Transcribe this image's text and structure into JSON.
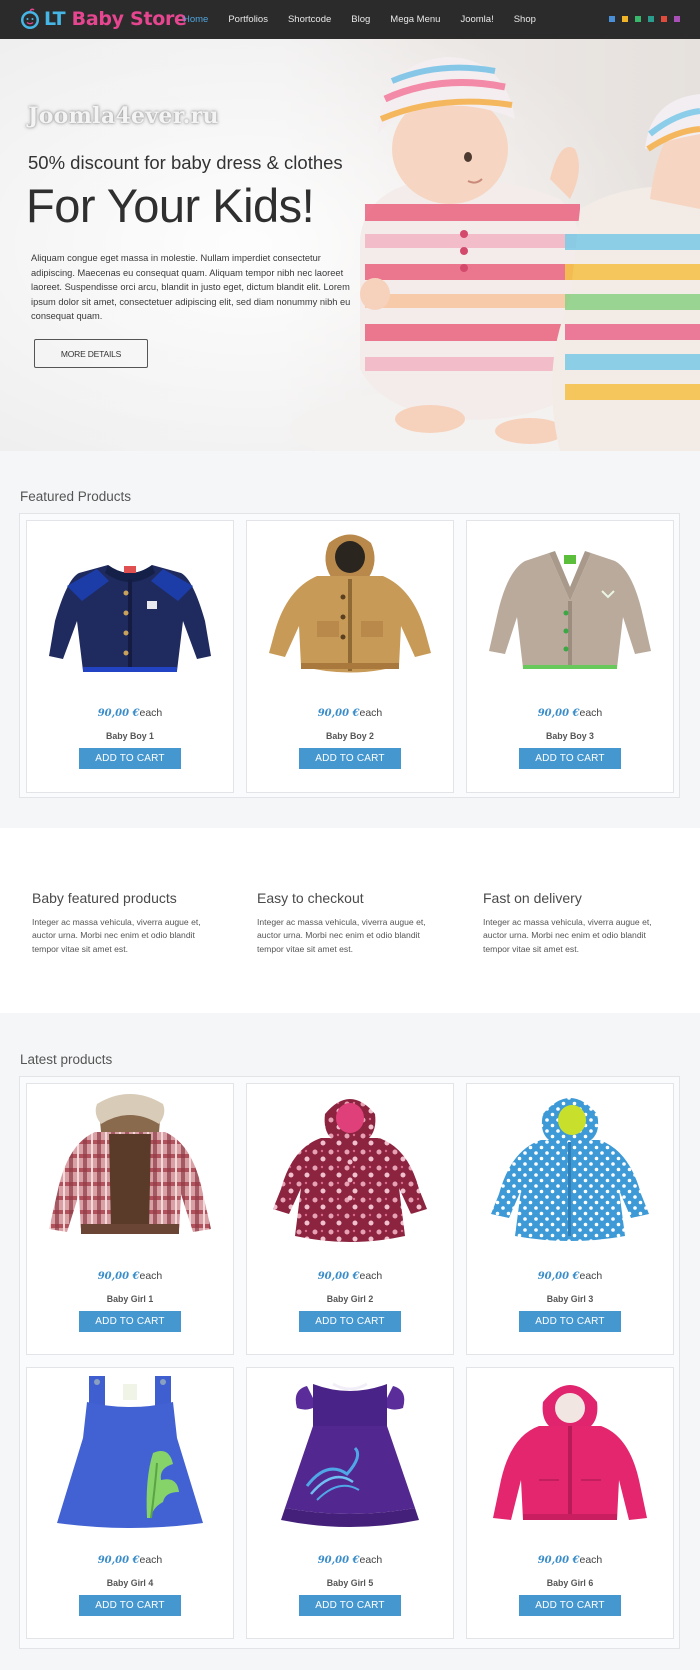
{
  "logo": {
    "part1": "LT",
    "part2": "Baby Store"
  },
  "menu": [
    {
      "label": "Home",
      "active": true
    },
    {
      "label": "Portfolios"
    },
    {
      "label": "Shortcode"
    },
    {
      "label": "Blog"
    },
    {
      "label": "Mega Menu"
    },
    {
      "label": "Joomla!"
    },
    {
      "label": "Shop"
    }
  ],
  "color_dots": [
    "#4a90d9",
    "#f0b429",
    "#38b86a",
    "#2a9d8f",
    "#e04b3b",
    "#a84fb8"
  ],
  "hero": {
    "watermark": "Joomla4ever.ru",
    "subtitle": "50% discount for baby dress & clothes",
    "title": "For Your Kids!",
    "text": "Aliquam congue eget massa in molestie. Nullam imperdiet consectetur adipiscing. Maecenas eu consequat quam. Aliquam tempor nibh nec laoreet laoreet. Suspendisse orci arcu, blandit in justo eget, dictum blandit elit. Lorem ipsum dolor sit amet, consectetuer adipiscing elit, sed diam nonummy nibh eu consequat quam.",
    "button": "MORE DETAILS"
  },
  "featured": {
    "title": "Featured Products",
    "products": [
      {
        "name": "Baby Boy 1",
        "price": "90,00 €",
        "unit": "each",
        "cart": "ADD TO CART",
        "image": "navy-cardigan"
      },
      {
        "name": "Baby Boy 2",
        "price": "90,00 €",
        "unit": "each",
        "cart": "ADD TO CART",
        "image": "tan-parka"
      },
      {
        "name": "Baby Boy 3",
        "price": "90,00 €",
        "unit": "each",
        "cart": "ADD TO CART",
        "image": "beige-cardigan"
      }
    ]
  },
  "features": [
    {
      "title": "Baby featured products",
      "text": "Integer ac massa vehicula, viverra augue et, auctor urna. Morbi nec enim et odio blandit tempor vitae sit amet est."
    },
    {
      "title": "Easy to checkout",
      "text": "Integer ac massa vehicula, viverra augue et, auctor urna. Morbi nec enim et odio blandit tempor vitae sit amet est."
    },
    {
      "title": "Fast on delivery",
      "text": "Integer ac massa vehicula, viverra augue et, auctor urna. Morbi nec enim et odio blandit tempor vitae sit amet est."
    }
  ],
  "latest": {
    "title": "Latest products",
    "products": [
      {
        "name": "Baby Girl 1",
        "price": "90,00 €",
        "unit": "each",
        "cart": "ADD TO CART",
        "image": "plaid-jacket"
      },
      {
        "name": "Baby Girl 2",
        "price": "90,00 €",
        "unit": "each",
        "cart": "ADD TO CART",
        "image": "floral-coat"
      },
      {
        "name": "Baby Girl 3",
        "price": "90,00 €",
        "unit": "each",
        "cart": "ADD TO CART",
        "image": "blue-dot-raincoat"
      },
      {
        "name": "Baby Girl 4",
        "price": "90,00 €",
        "unit": "each",
        "cart": "ADD TO CART",
        "image": "blue-pinafore-dress"
      },
      {
        "name": "Baby Girl 5",
        "price": "90,00 €",
        "unit": "each",
        "cart": "ADD TO CART",
        "image": "purple-dress"
      },
      {
        "name": "Baby Girl 6",
        "price": "90,00 €",
        "unit": "each",
        "cart": "ADD TO CART",
        "image": "pink-hoodie"
      }
    ]
  }
}
